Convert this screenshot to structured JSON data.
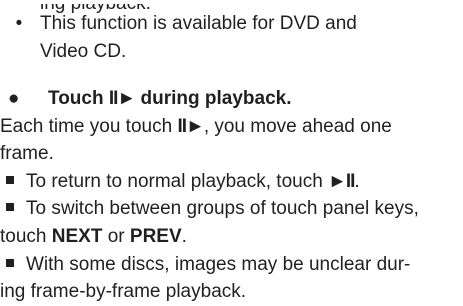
{
  "lines": {
    "top_partial": "ing playback.",
    "bullet1_a": "This function is available for DVD and",
    "bullet1_b": "Video CD.",
    "step": {
      "prefix": "Touch ",
      "symbol": "II►",
      "suffix": " during playback."
    },
    "para_a_prefix": "Each time you touch ",
    "para_a_symbol": "II►",
    "para_a_suffix": ", you move ahead one",
    "para_b": "frame.",
    "note1_prefix": "To return to normal playback, touch ",
    "note1_symbol": "►II",
    "note1_suffix": ".",
    "note2_a": "To switch between groups of touch panel keys,",
    "note2_b_prefix": "touch ",
    "note2_b_next": "NEXT",
    "note2_b_or": " or ",
    "note2_b_prev": "PREV",
    "note2_b_suffix": ".",
    "note3_a": "With some discs, images may be unclear dur-",
    "note3_b": "ing frame-by-frame playback."
  },
  "bullet_glyph": "•",
  "step_glyph": "●"
}
